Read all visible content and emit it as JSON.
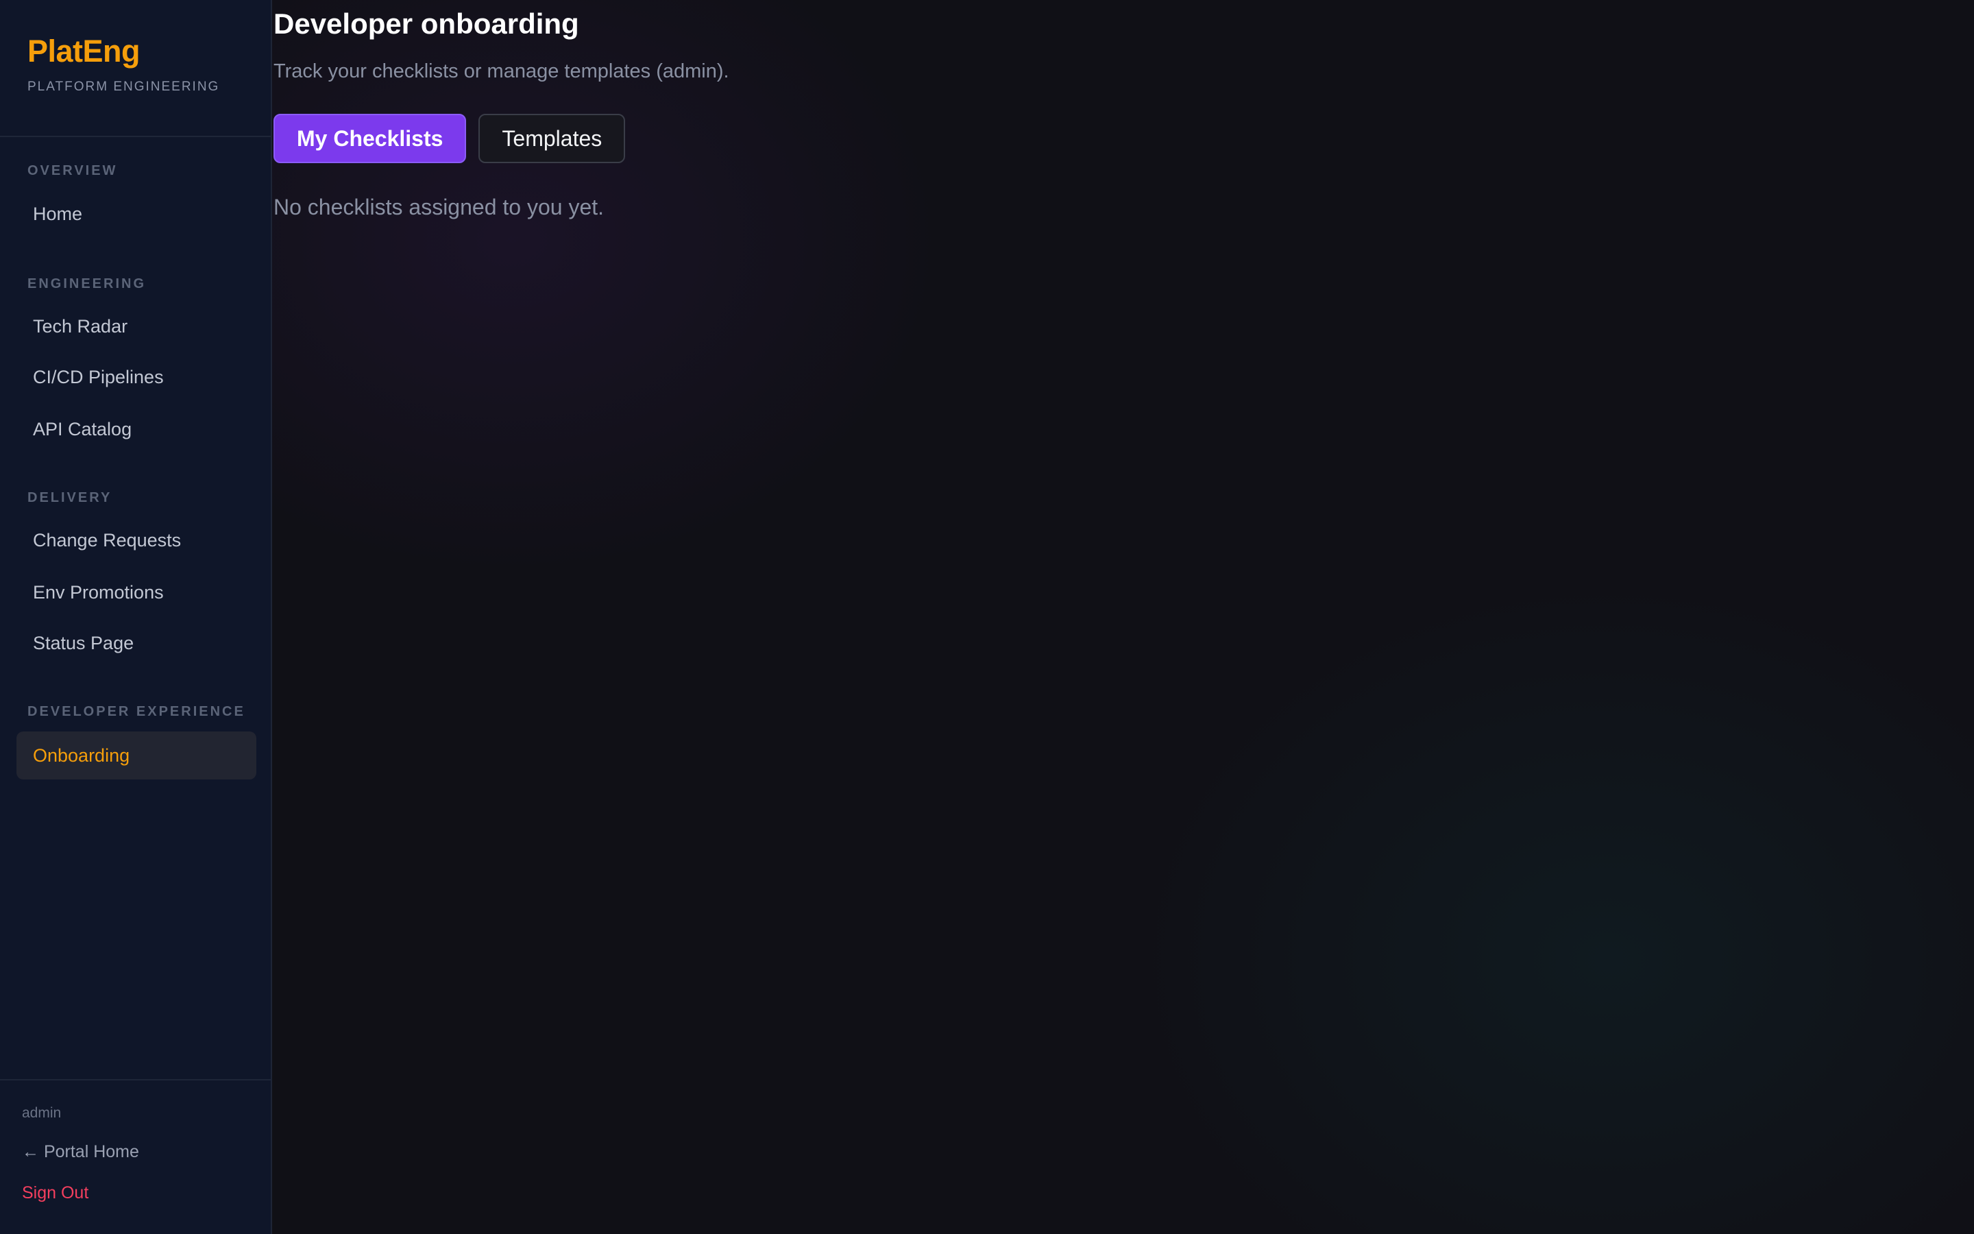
{
  "brand": {
    "title": "PlatEng",
    "subtitle": "PLATFORM ENGINEERING"
  },
  "sidebar": {
    "sections": [
      {
        "label": "OVERVIEW",
        "items": [
          {
            "label": "Home"
          }
        ]
      },
      {
        "label": "ENGINEERING",
        "items": [
          {
            "label": "Tech Radar"
          },
          {
            "label": "CI/CD Pipelines"
          },
          {
            "label": "API Catalog"
          }
        ]
      },
      {
        "label": "DELIVERY",
        "items": [
          {
            "label": "Change Requests"
          },
          {
            "label": "Env Promotions"
          },
          {
            "label": "Status Page"
          }
        ]
      },
      {
        "label": "DEVELOPER EXPERIENCE",
        "items": [
          {
            "label": "Onboarding",
            "active": true
          }
        ]
      }
    ],
    "footer": {
      "user": "admin",
      "portal_home": "← Portal Home",
      "sign_out": "Sign Out"
    }
  },
  "main": {
    "title": "Developer onboarding",
    "subtitle": "Track your checklists or manage templates (admin).",
    "tabs": [
      {
        "label": "My Checklists",
        "active": true
      },
      {
        "label": "Templates",
        "active": false
      }
    ],
    "empty_message": "No checklists assigned to you yet."
  },
  "colors": {
    "accent": "#f59e0b",
    "primary_button": "#7c3aed",
    "danger": "#f43f5e",
    "sidebar_bg": "#0f1629"
  }
}
